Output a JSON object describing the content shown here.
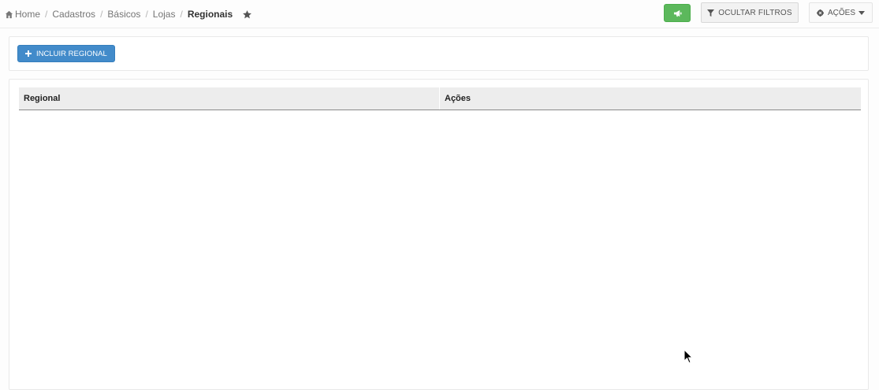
{
  "breadcrumb": {
    "items": [
      "Home",
      "Cadastros",
      "Básicos",
      "Lojas"
    ],
    "current": "Regionais",
    "separator": "/"
  },
  "toolbar": {
    "filters_label": "OCULTAR FILTROS",
    "actions_label": "AÇÕES"
  },
  "panel": {
    "include_label": "INCLUIR REGIONAL"
  },
  "grid": {
    "columns": [
      "Regional",
      "Ações"
    ],
    "rows": []
  },
  "colors": {
    "primary": "#428bca",
    "success": "#5cb85c",
    "header_bg": "#ededed"
  },
  "icons": [
    "home-icon",
    "star-icon",
    "bullhorn-icon",
    "funnel-icon",
    "cog-icon",
    "caret-down-icon",
    "plus-icon"
  ]
}
